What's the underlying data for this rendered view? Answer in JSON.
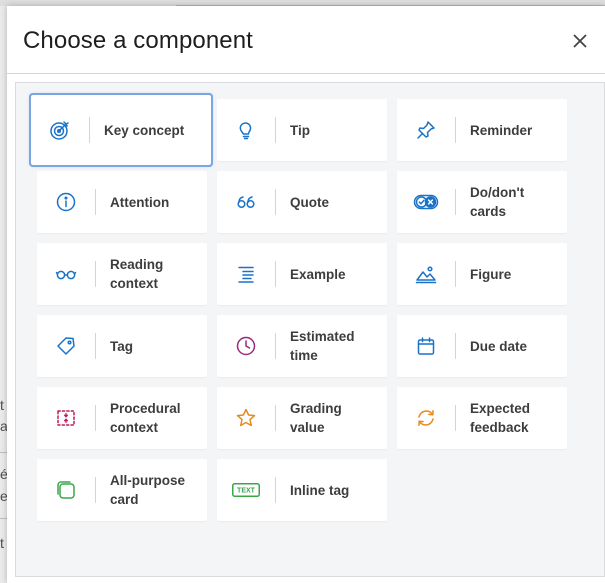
{
  "dialog": {
    "title": "Choose a component",
    "close_label": "×"
  },
  "background_fragments": [
    "t",
    "a",
    "é",
    "e",
    "t"
  ],
  "components": [
    {
      "label": "Key concept",
      "icon": "target-icon",
      "color": "#1a73c9",
      "selected": true
    },
    {
      "label": "Tip",
      "icon": "lightbulb-icon",
      "color": "#1a73c9"
    },
    {
      "label": "Reminder",
      "icon": "pushpin-icon",
      "color": "#1a73c9"
    },
    {
      "label": "Attention",
      "icon": "info-circle-icon",
      "color": "#1a73c9"
    },
    {
      "label": "Quote",
      "icon": "quote-icon",
      "color": "#1a73c9"
    },
    {
      "label": "Do/don't cards",
      "icon": "check-x-cards-icon",
      "color": "#1a73c9"
    },
    {
      "label": "Reading context",
      "icon": "glasses-icon",
      "color": "#1a73c9"
    },
    {
      "label": "Example",
      "icon": "list-lines-icon",
      "color": "#1a73c9"
    },
    {
      "label": "Figure",
      "icon": "landscape-icon",
      "color": "#1a73c9"
    },
    {
      "label": "Tag",
      "icon": "tag-icon",
      "color": "#1a73c9"
    },
    {
      "label": "Estimated time",
      "icon": "clock-icon",
      "color": "#9c2a7a"
    },
    {
      "label": "Due date",
      "icon": "calendar-icon",
      "color": "#1a73c9"
    },
    {
      "label": "Procedural context",
      "icon": "dashed-box-icon",
      "color": "#c2185b"
    },
    {
      "label": "Grading value",
      "icon": "star-icon",
      "color": "#e58a1f"
    },
    {
      "label": "Expected feedback",
      "icon": "refresh-icon",
      "color": "#e58a1f"
    },
    {
      "label": "All-purpose card",
      "icon": "rounded-square-icon",
      "color": "#3aa64a"
    },
    {
      "label": "Inline tag",
      "icon": "text-tag-icon",
      "color": "#3aa64a",
      "icon_text": "TEXT"
    }
  ]
}
